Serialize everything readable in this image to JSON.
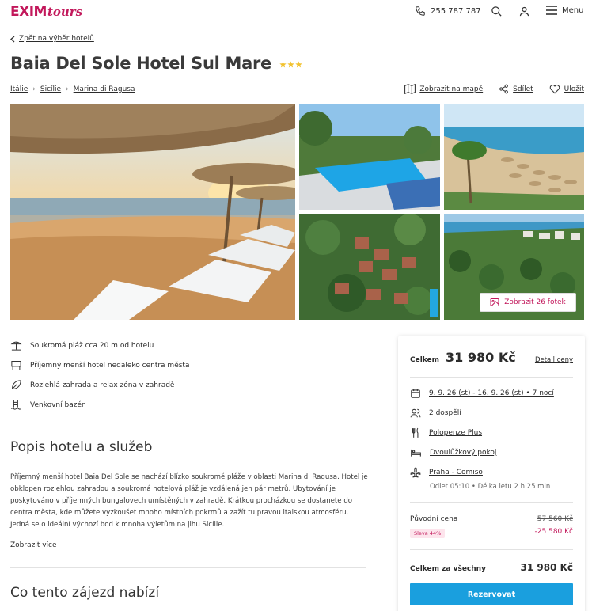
{
  "header": {
    "logo_primary": "EXIM",
    "logo_secondary": "tours",
    "phone": "255 787 787",
    "menu_label": "Menu",
    "brand_color": "#c2185b"
  },
  "nav": {
    "back_label": "Zpět na výběr hotelů",
    "breadcrumbs": [
      "Itálie",
      "Sicílie",
      "Marina di Ragusa"
    ],
    "actions": {
      "map": "Zobrazit na mapě",
      "share": "Sdílet",
      "save": "Uložit"
    }
  },
  "hotel": {
    "name": "Baia Del Sole Hotel Sul Mare",
    "stars": 3,
    "photos_button": "Zobrazit 26 fotek"
  },
  "features": [
    {
      "icon": "beach-umbrella-icon",
      "text": "Soukromá pláž cca 20 m od hotelu"
    },
    {
      "icon": "hotel-building-icon",
      "text": "Příjemný menší hotel nedaleko centra města"
    },
    {
      "icon": "leaf-icon",
      "text": "Rozlehlá zahrada a relax zóna v zahradě"
    },
    {
      "icon": "pool-icon",
      "text": "Venkovní bazén"
    }
  ],
  "description": {
    "heading": "Popis hotelu a služeb",
    "text": "Příjemný menší hotel Baia Del Sole se nachází blízko soukromé pláže v oblasti Marina di Ragusa. Hotel je obklopen rozlehlou zahradou a soukromá hotelová pláž je vzdálená jen pár metrů. Ubytování je poskytováno v příjemných bungalovech umístěných v zahradě. Krátkou procházkou se dostanete do centra města, kde můžete vyzkoušet mnoho místních pokrmů a zažít tu pravou italskou atmosféru. Jedná se o ideální výchozí bod k mnoha výletům na jihu Sicílie.",
    "more_label": "Zobrazit více"
  },
  "offer_heading": "Co tento zájezd nabízí",
  "booking": {
    "total_label": "Celkem",
    "total_price": "31 980 Kč",
    "detail_label": "Detail ceny",
    "dates": "9. 9. 26 (st) - 16. 9. 26 (st) • 7 nocí",
    "travelers": "2 dospělí",
    "board": "Polopenze Plus",
    "room": "Dvoulůžkový pokoj",
    "flight": "Praha - Comiso",
    "flight_info": "Odlet 05:10 • Délka letu 2 h 25 min",
    "original_label": "Původní cena",
    "original_price": "57 560 Kč",
    "discount_badge": "Sleva 44%",
    "discount_amount": "-25 580 Kč",
    "grand_label": "Celkem za všechny",
    "grand_price": "31 980 Kč",
    "reserve_label": "Rezervovat",
    "button_color": "#1a9fde"
  }
}
